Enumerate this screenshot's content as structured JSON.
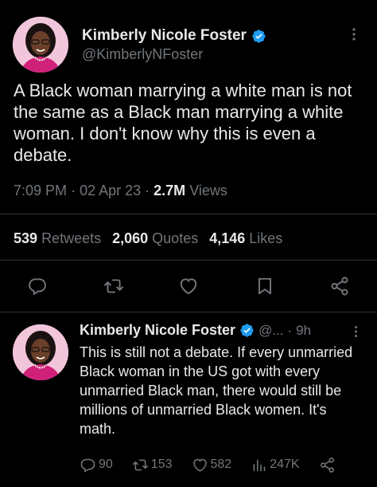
{
  "main_tweet": {
    "display_name": "Kimberly Nicole Foster",
    "handle": "@KimberlyNFoster",
    "text": "A Black woman marrying a white man is not the same as a Black man marrying a white woman. I don't know why this is even a debate.",
    "time": "7:09 PM",
    "date": "02 Apr 23",
    "views_count": "2.7M",
    "views_label": "Views",
    "retweets_count": "539",
    "retweets_label": "Retweets",
    "quotes_count": "2,060",
    "quotes_label": "Quotes",
    "likes_count": "4,146",
    "likes_label": "Likes"
  },
  "reply_tweet": {
    "display_name": "Kimberly Nicole Foster",
    "handle": "@...",
    "time": "9h",
    "text": "This is still not a debate. If every unmarried Black woman in the US got with every unmarried Black man, there would still be millions of unmarried Black women. It's math.",
    "replies": "90",
    "retweets": "153",
    "likes": "582",
    "views": "247K"
  },
  "colors": {
    "background": "#000000",
    "text_primary": "#e7e9ea",
    "text_secondary": "#71767b",
    "verified_blue": "#1d9bf0",
    "divider": "#2f3336"
  },
  "icons": [
    "verified-badge-icon",
    "more-icon",
    "reply-icon",
    "retweet-icon",
    "like-icon",
    "bookmark-icon",
    "share-icon",
    "views-icon"
  ]
}
